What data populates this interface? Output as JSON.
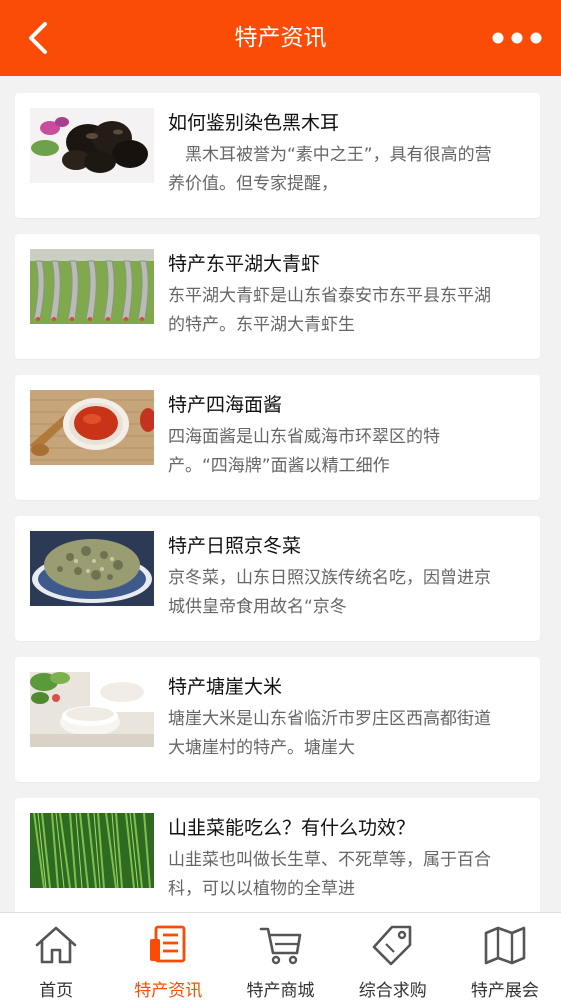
{
  "header": {
    "title": "特产资讯",
    "back_icon": "chevron-left-icon",
    "more_icon": "more-dots-icon"
  },
  "colors": {
    "accent": "#fa4c06",
    "background": "#f2f2f2",
    "card": "#ffffff",
    "title_text": "#111111",
    "desc_text": "#666666"
  },
  "articles": [
    {
      "title": "如何鉴别染色黑木耳",
      "desc": "　黑木耳被誉为“素中之王”，具有很高的营养价值。但专家提醒，",
      "thumb": "black-fungus-image"
    },
    {
      "title": "特产东平湖大青虾",
      "desc": "东平湖大青虾是山东省泰安市东平县东平湖的特产。东平湖大青虾生",
      "thumb": "shrimp-image"
    },
    {
      "title": "特产四海面酱",
      "desc": "四海面酱是山东省威海市环翠区的特产。“四海牌”面酱以精工细作",
      "thumb": "sauce-bowl-image"
    },
    {
      "title": "特产日照京冬菜",
      "desc": "京冬菜，山东日照汉族传统名吃，因曾进京城供皇帝食用故名“京冬",
      "thumb": "preserved-vegetable-image"
    },
    {
      "title": "特产塘崖大米",
      "desc": "塘崖大米是山东省临沂市罗庄区西高都街道大塘崖村的特产。塘崖大",
      "thumb": "rice-bowl-image"
    },
    {
      "title": "山韭菜能吃么？有什么功效？",
      "desc": "山韭菜也叫做长生草、不死草等，属于百合科，可以以植物的全草进",
      "thumb": "wild-chives-image"
    }
  ],
  "tabbar": {
    "active_index": 1,
    "items": [
      {
        "label": "首页",
        "icon": "home-icon"
      },
      {
        "label": "特产资讯",
        "icon": "news-icon"
      },
      {
        "label": "特产商城",
        "icon": "cart-icon"
      },
      {
        "label": "综合求购",
        "icon": "tag-icon"
      },
      {
        "label": "特产展会",
        "icon": "map-icon"
      }
    ]
  }
}
